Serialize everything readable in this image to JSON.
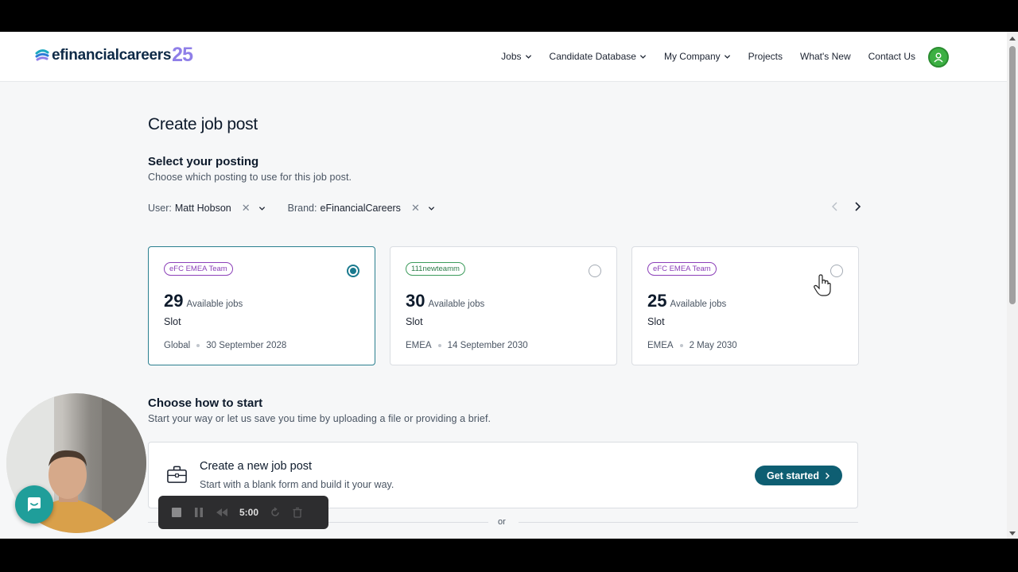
{
  "header": {
    "logo_text": "efinancialcareers",
    "logo_number": "25",
    "nav": [
      {
        "label": "Jobs",
        "has_dropdown": true
      },
      {
        "label": "Candidate Database",
        "has_dropdown": true
      },
      {
        "label": "My Company",
        "has_dropdown": true
      },
      {
        "label": "Projects",
        "has_dropdown": false
      },
      {
        "label": "What's New",
        "has_dropdown": false
      },
      {
        "label": "Contact Us",
        "has_dropdown": false
      }
    ]
  },
  "page": {
    "title": "Create job post",
    "posting": {
      "title": "Select your posting",
      "subtitle": "Choose which posting to use for this job post."
    },
    "filters": {
      "user_label": "User:",
      "user_value": "Matt Hobson",
      "brand_label": "Brand:",
      "brand_value": "eFinancialCareers"
    },
    "cards": [
      {
        "tag": "eFC EMEA Team",
        "count": "29",
        "count_label": "Available jobs",
        "type": "Slot",
        "region": "Global",
        "date": "30 September 2028",
        "selected": true
      },
      {
        "tag": "111newteamm",
        "count": "30",
        "count_label": "Available jobs",
        "type": "Slot",
        "region": "EMEA",
        "date": "14 September 2030",
        "selected": false
      },
      {
        "tag": "eFC EMEA Team",
        "count": "25",
        "count_label": "Available jobs",
        "type": "Slot",
        "region": "EMEA",
        "date": "2 May 2030",
        "selected": false
      }
    ],
    "start": {
      "title": "Choose how to start",
      "subtitle": "Start your way or let us save you time by uploading a file or providing a brief.",
      "option_title": "Create a new job post",
      "option_subtitle": "Start with a blank form and build it your way.",
      "button_label": "Get started",
      "or_text": "or"
    }
  },
  "recorder": {
    "time": "5:00"
  },
  "colors": {
    "accent": "#0e5e72",
    "selected_border": "#2a7f8f",
    "tag_purple": "#8b3fb8",
    "tag_green": "#3c9b5b",
    "logo_purple": "#8f7fe8"
  }
}
